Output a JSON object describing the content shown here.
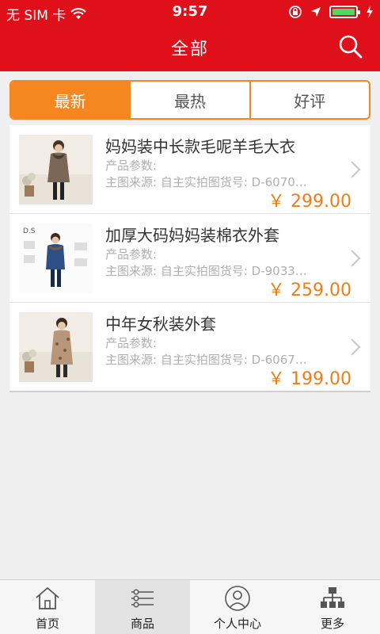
{
  "status_bar": {
    "carrier": "无 SIM 卡",
    "time": "9:57",
    "wifi_icon": "wifi-icon",
    "lock_icon": "orientation-lock-icon",
    "location_icon": "location-arrow-icon",
    "battery_icon": "battery-icon",
    "charging_icon": "charging-bolt-icon"
  },
  "nav": {
    "title": "全部",
    "search_icon": "search-icon"
  },
  "segments": [
    {
      "label": "最新",
      "active": true
    },
    {
      "label": "最热",
      "active": false
    },
    {
      "label": "好评",
      "active": false
    }
  ],
  "products": [
    {
      "name": "妈妈装中长款毛呢羊毛大衣",
      "params": "产品参数:",
      "source": "主图来源: 自主实拍图货号: D-6070…",
      "price": "￥ 299.00"
    },
    {
      "name": "加厚大码妈妈装棉衣外套",
      "params": "产品参数:",
      "source": "主图来源: 自主实拍图货号: D-9033…",
      "price": "￥ 259.00"
    },
    {
      "name": "中年女秋装外套",
      "params": "产品参数:",
      "source": "主图来源: 自主实拍图货号: D-6067…",
      "price": "￥ 199.00"
    }
  ],
  "thumb2_text": "D.S",
  "tabs": [
    {
      "label": "首页",
      "icon": "home-icon",
      "active": false
    },
    {
      "label": "商品",
      "icon": "list-icon",
      "active": true
    },
    {
      "label": "个人中心",
      "icon": "user-icon",
      "active": false
    },
    {
      "label": "更多",
      "icon": "sitemap-icon",
      "active": false
    }
  ],
  "colors": {
    "brand_red": "#e0101a",
    "accent_orange": "#f6861f",
    "price_orange": "#f07c13"
  }
}
